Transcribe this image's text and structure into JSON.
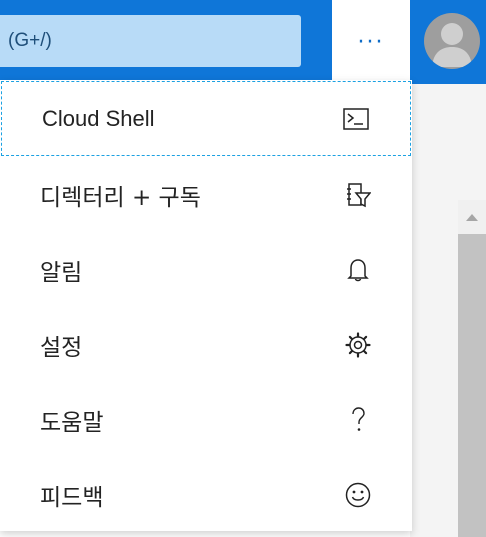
{
  "header": {
    "search_text": "(G+/)",
    "more_label": "···",
    "accent_color": "#0f76d8",
    "search_bg_color": "#b8dbf7"
  },
  "menu": {
    "items": [
      {
        "label": "Cloud Shell",
        "icon": "cloud-shell-terminal-icon"
      },
      {
        "label": "디렉터리 + 구독",
        "icon": "directory-subscription-filter-icon"
      },
      {
        "label": "알림",
        "icon": "bell-icon"
      },
      {
        "label": "설정",
        "icon": "gear-icon"
      },
      {
        "label": "도움말",
        "icon": "question-mark-icon"
      },
      {
        "label": "피드백",
        "icon": "smiley-icon"
      }
    ],
    "focus_color": "#1ba1e2"
  }
}
